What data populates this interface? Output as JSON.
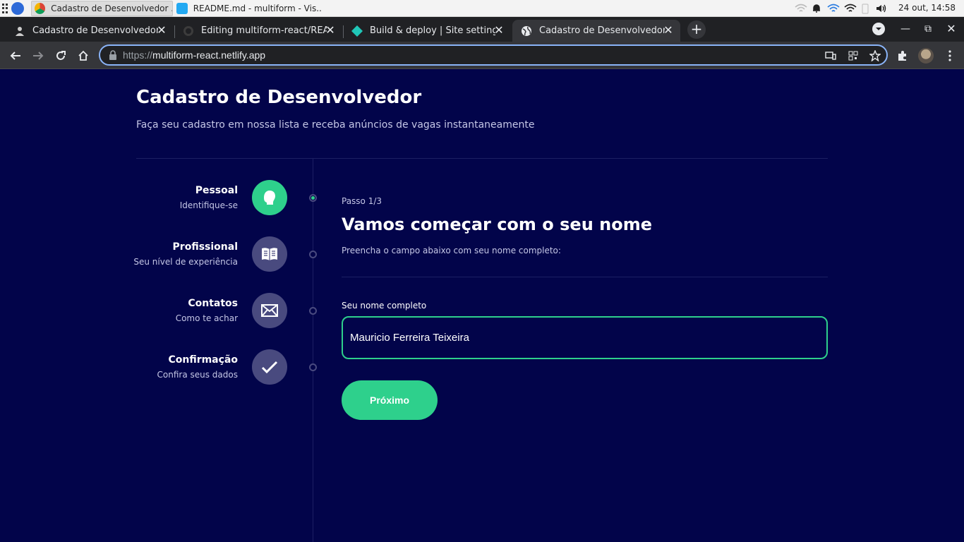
{
  "taskbar": {
    "tasks": [
      {
        "label": "Cadastro de Desenvolvedor ...",
        "icon": "chrome-icon",
        "active": true
      },
      {
        "label": "README.md - multiform - Vis...",
        "icon": "vscode-icon",
        "active": false
      }
    ],
    "clock": "24 out, 14:58"
  },
  "browser": {
    "tabs": [
      {
        "label": "Cadastro de Desenvolvedor",
        "icon": "app-favicon",
        "active": false
      },
      {
        "label": "Editing multiform-react/README",
        "icon": "github-icon",
        "active": false
      },
      {
        "label": "Build & deploy | Site settings",
        "icon": "netlify-icon",
        "active": false
      },
      {
        "label": "Cadastro de Desenvolvedor",
        "icon": "globe-icon",
        "active": true
      }
    ],
    "url_protocol": "https://",
    "url_host": "multiform-react.netlify.app"
  },
  "page": {
    "title": "Cadastro de Desenvolvedor",
    "subtitle": "Faça seu cadastro em nossa lista e receba anúncios de vagas instantaneamente",
    "steps": [
      {
        "title": "Pessoal",
        "description": "Identifique-se",
        "icon": "user-icon",
        "active": true
      },
      {
        "title": "Profissional",
        "description": "Seu nível de experiência",
        "icon": "book-icon",
        "active": false
      },
      {
        "title": "Contatos",
        "description": "Como te achar",
        "icon": "mail-icon",
        "active": false
      },
      {
        "title": "Confirmação",
        "description": "Confira seus dados",
        "icon": "check-icon",
        "active": false
      }
    ],
    "form": {
      "step_counter": "Passo 1/3",
      "title": "Vamos começar com o seu nome",
      "description": "Preencha o campo abaixo com seu nome completo:",
      "field_label": "Seu nome completo",
      "field_value": "Mauricio Ferreira Teixeira",
      "next_label": "Próximo"
    }
  },
  "colors": {
    "background": "#02044a",
    "accent": "#2ed08c",
    "inactive_step": "#494a7f"
  }
}
